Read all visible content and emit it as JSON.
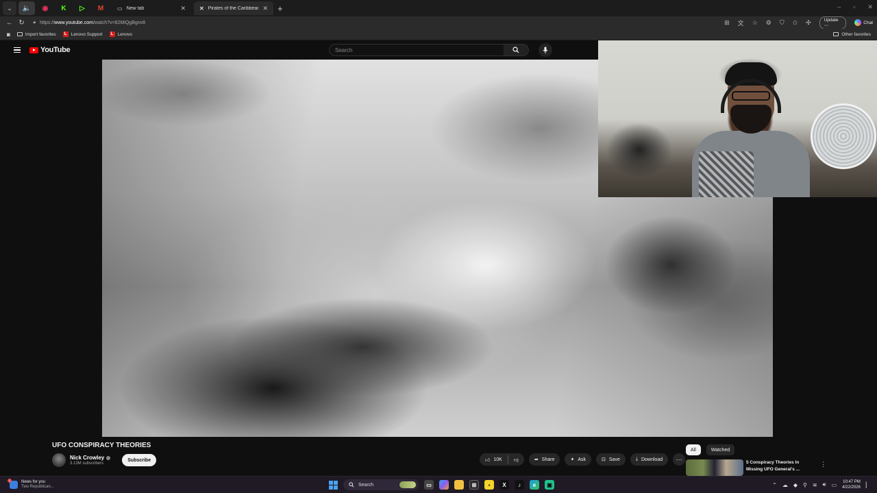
{
  "browser": {
    "tabs": [
      {
        "label": "New tab",
        "active": false
      },
      {
        "label": "Pirates of the Caribbean: At World",
        "active": true
      }
    ],
    "new_tab_symbol": "+",
    "url": {
      "scheme": "https://",
      "host": "www.youtube.com",
      "path": "/watch?v=82MiQgBgnv8"
    },
    "update_label": "Update",
    "chat_label": "Chat",
    "favorites": [
      {
        "label": "Import favorites",
        "icon": "folder-icon"
      },
      {
        "label": "Lenovo Support",
        "badge": "L"
      },
      {
        "label": "Lenovo",
        "badge": "L"
      }
    ],
    "other_favorites_label": "Other favorites"
  },
  "youtube": {
    "logo_text": "YouTube",
    "search_placeholder": "Search",
    "video_title": "UFO CONSPIRACY THEORIES",
    "channel": {
      "name": "Nick Crowley",
      "subscribers": "3.13M subscribers"
    },
    "subscribe_label": "Subscribe",
    "actions": {
      "likes": "10K",
      "share": "Share",
      "ask": "Ask",
      "save": "Save",
      "download": "Download"
    },
    "chips": [
      "All",
      "Watched"
    ],
    "recommendation": {
      "title": "5 Conspiracy Theories In Missing UFO General's ..."
    }
  },
  "taskbar": {
    "news_title": "News for you",
    "news_subtitle": "Two Republican...",
    "news_badge": "1",
    "search_label": "Search",
    "time": "10:47 PM",
    "date": "4/22/2026"
  },
  "colors": {
    "youtube_red": "#ff0000",
    "background": "#0f0f0f",
    "chip_bg": "#272727"
  }
}
